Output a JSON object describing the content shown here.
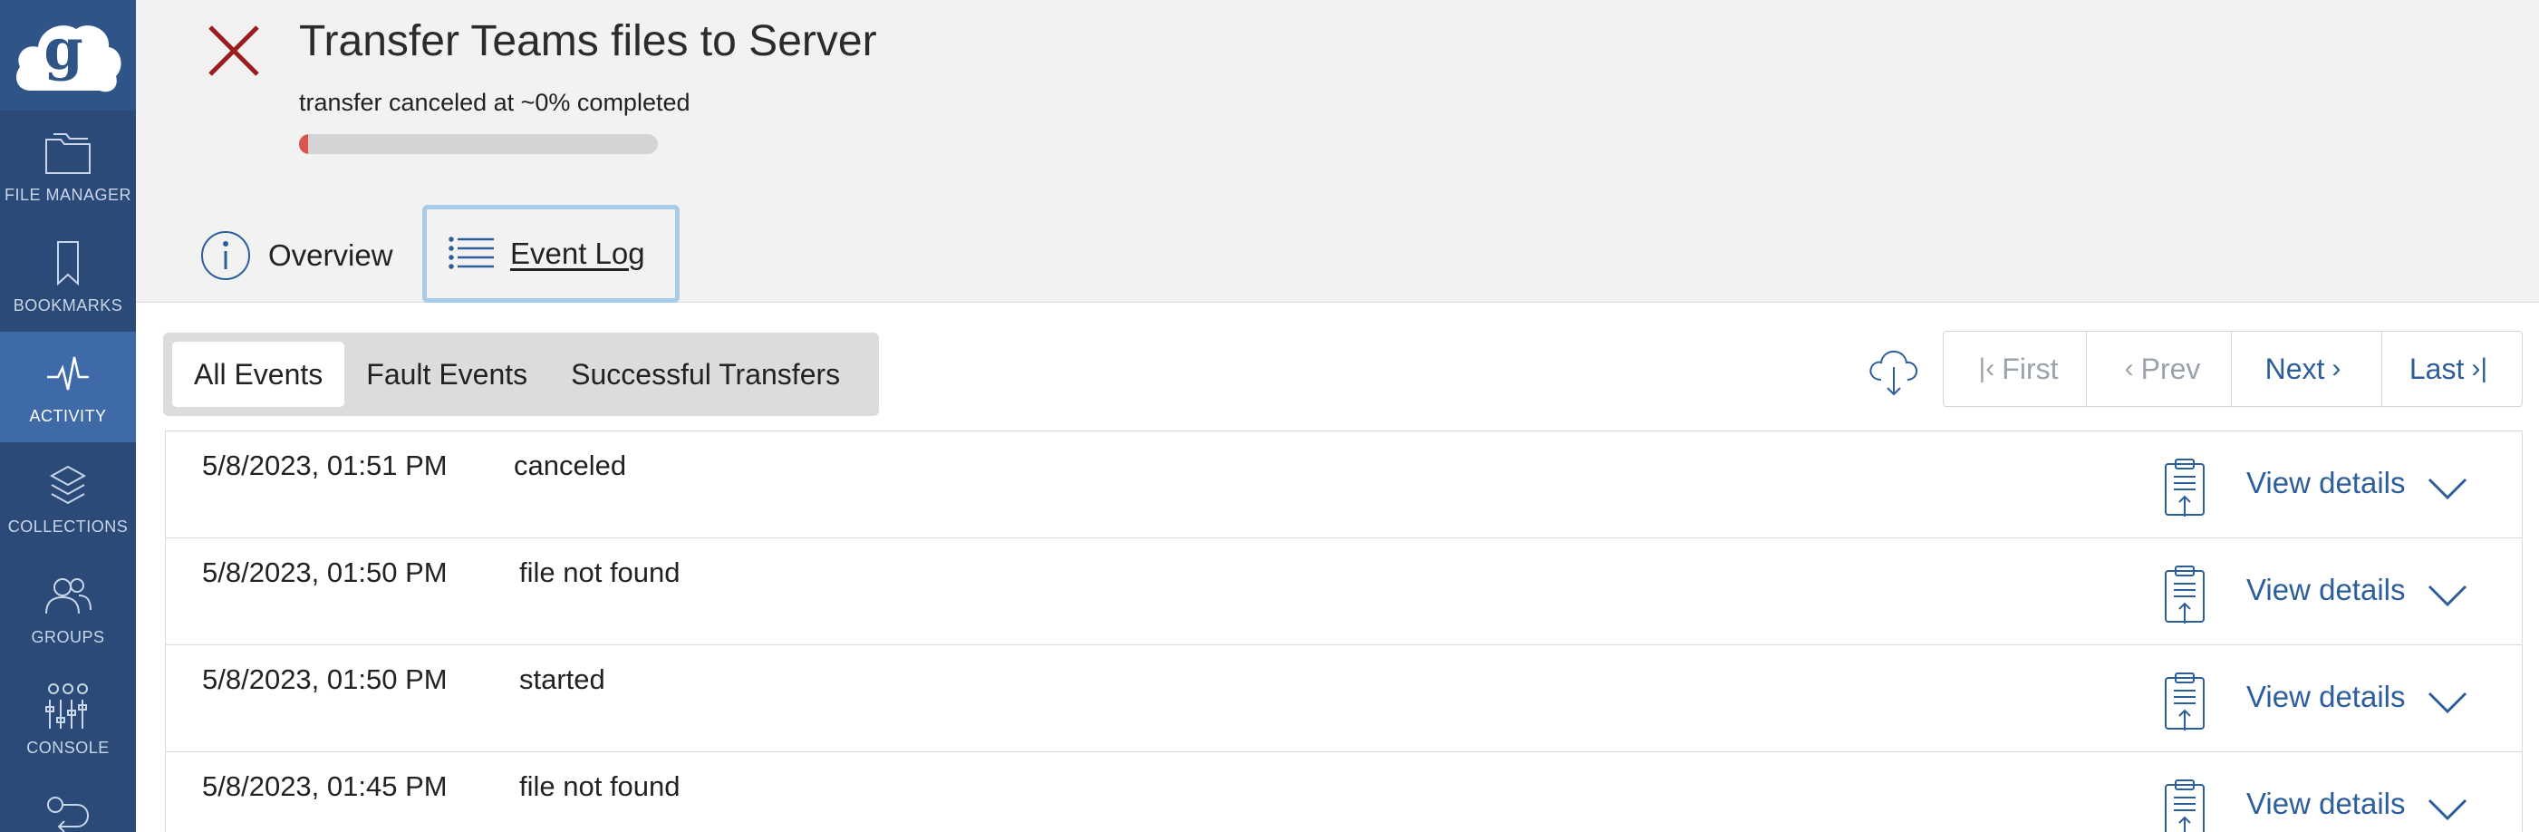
{
  "colors": {
    "sidebar_bg": "#2b4a77",
    "sidebar_active": "#3e6aa7",
    "accent_link": "#2d5e9c",
    "cancel_red": "#9b1c1c",
    "progress_red": "#d9534f"
  },
  "sidebar": {
    "logo_icon": "globus-cloud-logo",
    "items": [
      {
        "label": "FILE MANAGER",
        "icon": "folder-icon",
        "active": false
      },
      {
        "label": "BOOKMARKS",
        "icon": "bookmark-icon",
        "active": false
      },
      {
        "label": "ACTIVITY",
        "icon": "pulse-icon",
        "active": true
      },
      {
        "label": "COLLECTIONS",
        "icon": "layers-icon",
        "active": false
      },
      {
        "label": "GROUPS",
        "icon": "users-icon",
        "active": false
      },
      {
        "label": "CONSOLE",
        "icon": "sliders-icon",
        "active": false
      },
      {
        "label": "",
        "icon": "flows-icon",
        "active": false
      }
    ]
  },
  "header": {
    "title": "Transfer Teams files to Server",
    "status": "transfer canceled at ~0% completed",
    "progress_fraction": 0.0,
    "tabs": [
      {
        "label": "Overview",
        "icon": "info-circle-icon",
        "active": false
      },
      {
        "label": "Event Log",
        "icon": "list-icon",
        "active": true
      }
    ]
  },
  "filters": {
    "options": [
      "All Events",
      "Fault Events",
      "Successful Transfers"
    ],
    "selected": "All Events"
  },
  "pager": {
    "first": "First",
    "prev": "Prev",
    "next": "Next",
    "last": "Last"
  },
  "events": [
    {
      "time": "5/8/2023, 01:51 PM",
      "event": "canceled",
      "details_label": "View details"
    },
    {
      "time": "5/8/2023, 01:50 PM",
      "event": "file not found",
      "details_label": "View details"
    },
    {
      "time": "5/8/2023, 01:50 PM",
      "event": "started",
      "details_label": "View details"
    },
    {
      "time": "5/8/2023, 01:45 PM",
      "event": "file not found",
      "details_label": "View details"
    }
  ]
}
